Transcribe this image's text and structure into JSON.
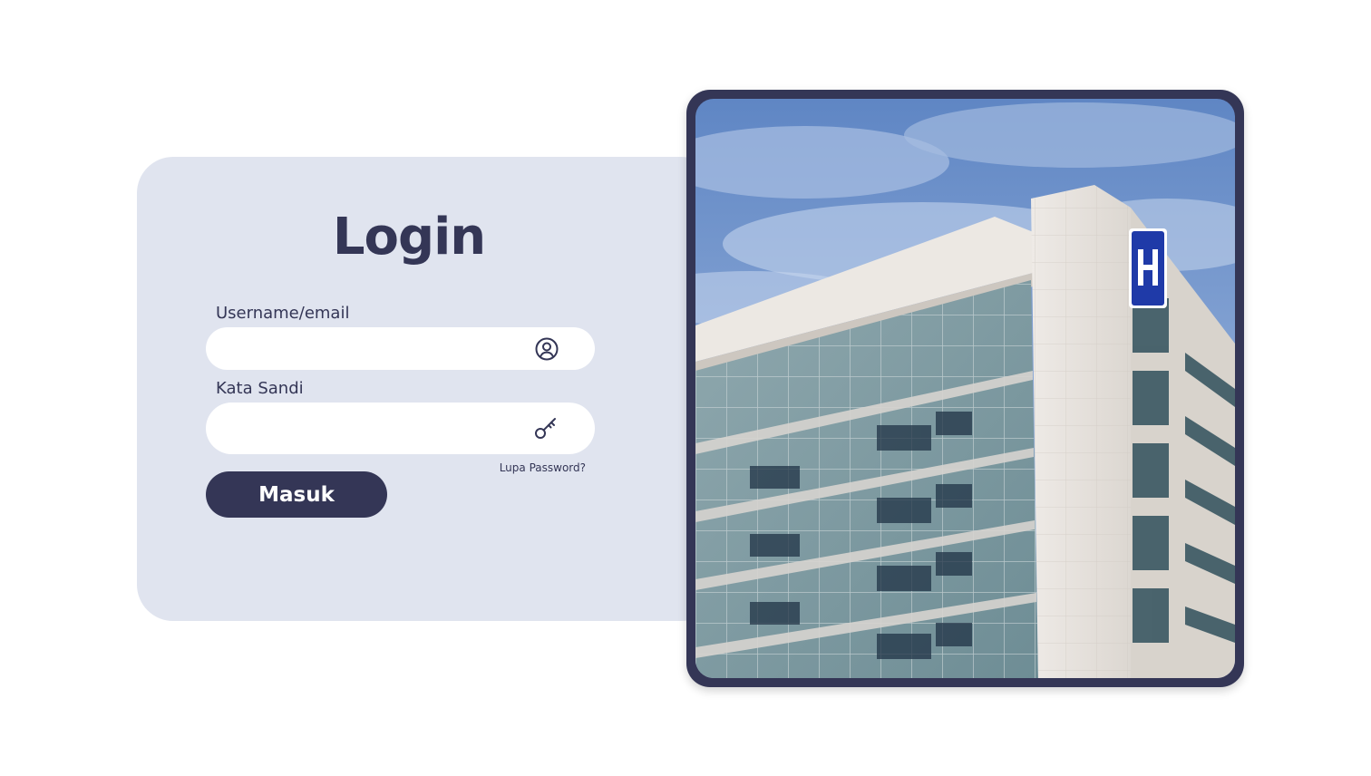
{
  "login": {
    "title": "Login",
    "username_label": "Username/email",
    "username_value": "",
    "password_label": "Kata Sandi",
    "password_value": "",
    "forgot_password": "Lupa Password?",
    "submit_label": "Masuk"
  },
  "icons": {
    "username": "user-circle-icon",
    "password": "key-icon"
  },
  "colors": {
    "primary": "#343656",
    "panel_background": "#e0e4ef",
    "input_background": "#ffffff"
  }
}
